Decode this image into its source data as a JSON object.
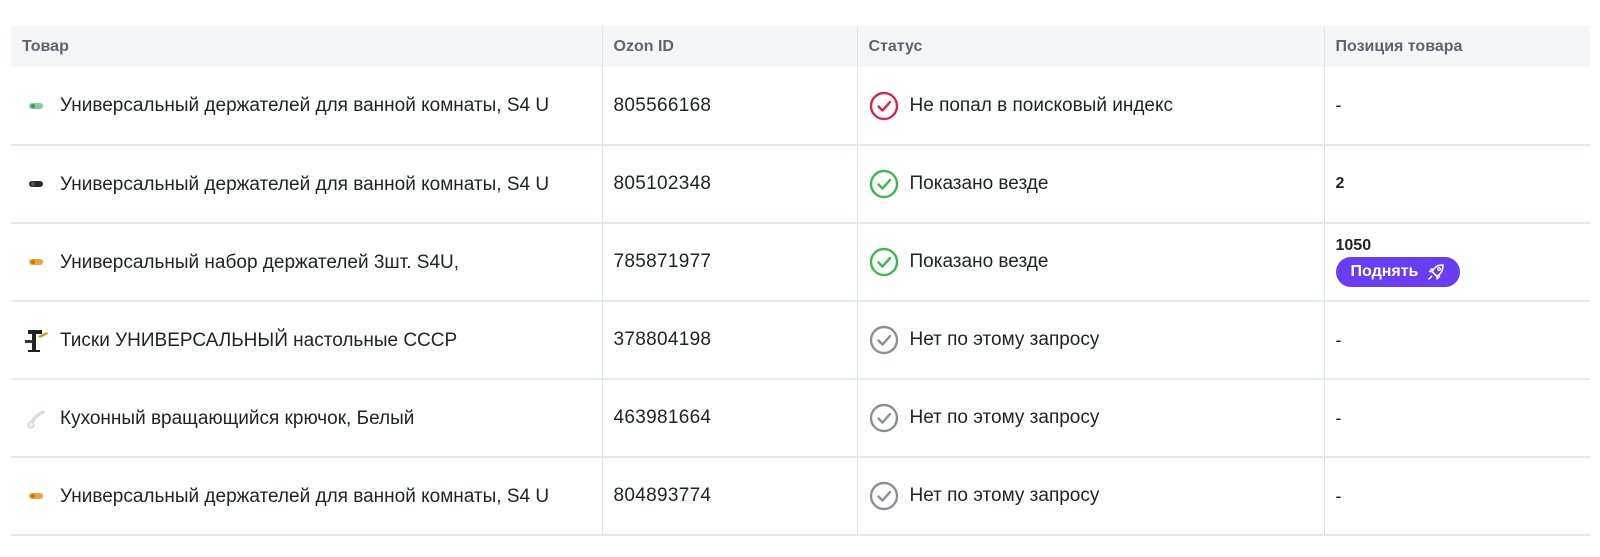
{
  "columns": {
    "product": "Товар",
    "ozon_id": "Ozon ID",
    "status": "Статус",
    "position": "Позиция товара"
  },
  "rows": [
    {
      "name": "Универсальный держателей для ванной комнаты, S4 U",
      "ozon_id": "805566168",
      "status": "Не попал в поисковый индекс",
      "status_kind": "error",
      "position": "-",
      "thumb": "green-holder"
    },
    {
      "name": "Универсальный держателей для ванной комнаты, S4 U",
      "ozon_id": "805102348",
      "status": "Показано везде",
      "status_kind": "success",
      "position": "2",
      "thumb": "black-holder"
    },
    {
      "name": "Универсальный набор держателей 3шт. S4U,",
      "ozon_id": "785871977",
      "status": "Показано везде",
      "status_kind": "success",
      "position": "1050",
      "thumb": "orange-holder",
      "action_label": "Поднять"
    },
    {
      "name": "Тиски УНИВЕРСАЛЬНЫЙ настольные СССР",
      "ozon_id": "378804198",
      "status": "Нет по этому запросу",
      "status_kind": "neutral",
      "position": "-",
      "thumb": "vise"
    },
    {
      "name": "Кухонный вращающийся крючок, Белый",
      "ozon_id": "463981664",
      "status": "Нет по этому запросу",
      "status_kind": "neutral",
      "position": "-",
      "thumb": "white-hook"
    },
    {
      "name": "Универсальный держателей для ванной комнаты, S4 U",
      "ozon_id": "804893774",
      "status": "Нет по этому запросу",
      "status_kind": "neutral",
      "position": "-",
      "thumb": "orange-holder"
    }
  ],
  "colors": {
    "error": "#d6264b",
    "success": "#3fb650",
    "neutral": "#8a8f98",
    "accent": "#6b3df0"
  }
}
